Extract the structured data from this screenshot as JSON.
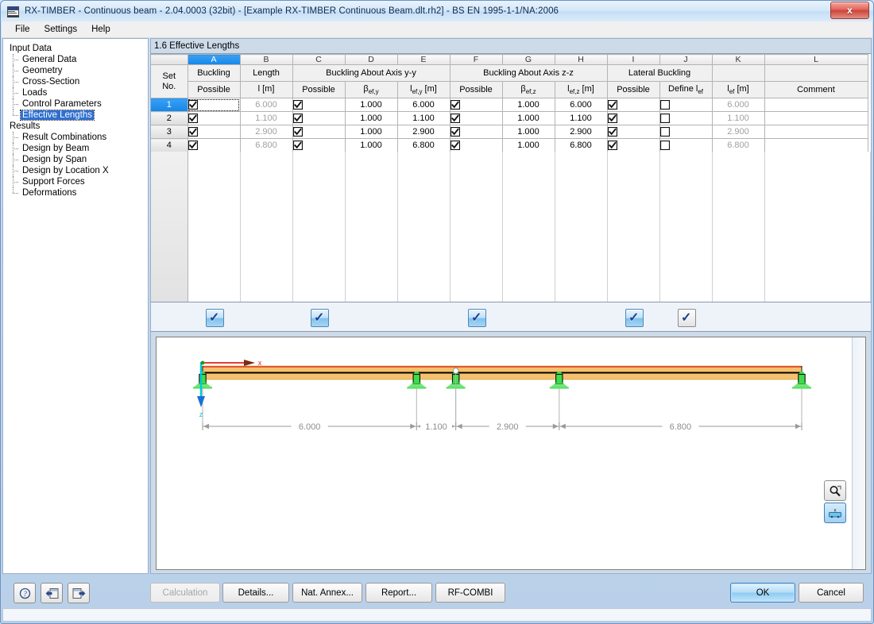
{
  "window": {
    "title": "RX-TIMBER - Continuous beam - 2.04.0003 (32bit) - [Example RX-TIMBER Continuous Beam.dlt.rh2] - BS EN 1995-1-1/NA:2006",
    "close_label": "x",
    "app_icon": "rx-timber-icon"
  },
  "menu": {
    "items": [
      {
        "label": "File"
      },
      {
        "label": "Settings"
      },
      {
        "label": "Help"
      }
    ]
  },
  "sidebar": {
    "groups": [
      {
        "label": "Input Data",
        "items": [
          {
            "label": "General Data",
            "selected": false
          },
          {
            "label": "Geometry",
            "selected": false
          },
          {
            "label": "Cross-Section",
            "selected": false
          },
          {
            "label": "Loads",
            "selected": false
          },
          {
            "label": "Control Parameters",
            "selected": false
          },
          {
            "label": "Effective Lengths",
            "selected": true
          }
        ]
      },
      {
        "label": "Results",
        "items": [
          {
            "label": "Result Combinations",
            "selected": false
          },
          {
            "label": "Design by Beam",
            "selected": false
          },
          {
            "label": "Design by Span",
            "selected": false
          },
          {
            "label": "Design by Location X",
            "selected": false
          },
          {
            "label": "Support Forces",
            "selected": false
          },
          {
            "label": "Deformations",
            "selected": false
          }
        ]
      }
    ]
  },
  "main": {
    "section_title": "1.6 Effective Lengths"
  },
  "table": {
    "column_letters": [
      "",
      "A",
      "B",
      "C",
      "D",
      "E",
      "F",
      "G",
      "H",
      "I",
      "J",
      "K",
      "L"
    ],
    "selected_column_letter": "A",
    "row_header": {
      "line1": "Set",
      "line2": "No."
    },
    "group_headers": [
      {
        "label": "Buckling",
        "span": 1
      },
      {
        "label": "Length",
        "span": 1
      },
      {
        "label": "Buckling About Axis y-y",
        "span": 3
      },
      {
        "label": "Buckling About Axis z-z",
        "span": 3
      },
      {
        "label": "Lateral Buckling",
        "span": 2
      },
      {
        "label": "",
        "span": 1
      },
      {
        "label": "",
        "span": 1
      }
    ],
    "sub_headers": [
      "Possible",
      "l [m]",
      "Possible",
      "βef,y",
      "lef,y [m]",
      "Possible",
      "βef,z",
      "lef,z [m]",
      "Possible",
      "Define lef",
      "lef [m]",
      "Comment"
    ],
    "sub_headers_rich": [
      {
        "text": "Possible"
      },
      {
        "base": "l",
        "sub": "",
        "unit": " [m]"
      },
      {
        "text": "Possible"
      },
      {
        "base": "β",
        "sub": "ef,y",
        "unit": ""
      },
      {
        "base": "l",
        "sub": "ef,y",
        "unit": " [m]"
      },
      {
        "text": "Possible"
      },
      {
        "base": "β",
        "sub": "ef,z",
        "unit": ""
      },
      {
        "base": "l",
        "sub": "ef,z",
        "unit": " [m]"
      },
      {
        "text": "Possible"
      },
      {
        "base": "Define l",
        "sub": "ef",
        "unit": ""
      },
      {
        "base": "l",
        "sub": "ef",
        "unit": " [m]"
      },
      {
        "text": "Comment"
      }
    ],
    "rows": [
      {
        "set_no": "1",
        "selected": true,
        "buckling_possible": true,
        "length": "6.000",
        "yy_possible": true,
        "beta_ef_y": "1.000",
        "l_ef_y": "6.000",
        "zz_possible": true,
        "beta_ef_z": "1.000",
        "l_ef_z": "6.000",
        "lat_possible": true,
        "define_lef": false,
        "l_ef": "6.000",
        "comment": ""
      },
      {
        "set_no": "2",
        "selected": false,
        "buckling_possible": true,
        "length": "1.100",
        "yy_possible": true,
        "beta_ef_y": "1.000",
        "l_ef_y": "1.100",
        "zz_possible": true,
        "beta_ef_z": "1.000",
        "l_ef_z": "1.100",
        "lat_possible": true,
        "define_lef": false,
        "l_ef": "1.100",
        "comment": ""
      },
      {
        "set_no": "3",
        "selected": false,
        "buckling_possible": true,
        "length": "2.900",
        "yy_possible": true,
        "beta_ef_y": "1.000",
        "l_ef_y": "2.900",
        "zz_possible": true,
        "beta_ef_z": "1.000",
        "l_ef_z": "2.900",
        "lat_possible": true,
        "define_lef": false,
        "l_ef": "2.900",
        "comment": ""
      },
      {
        "set_no": "4",
        "selected": false,
        "buckling_possible": true,
        "length": "6.800",
        "yy_possible": true,
        "beta_ef_y": "1.000",
        "l_ef_y": "6.800",
        "zz_possible": true,
        "beta_ef_z": "1.000",
        "l_ef_z": "6.800",
        "lat_possible": true,
        "define_lef": false,
        "l_ef": "6.800",
        "comment": ""
      }
    ]
  },
  "select_all_strip": {
    "checkboxes": [
      {
        "column": "A",
        "checked": true,
        "style": "blue"
      },
      {
        "column": "C",
        "checked": true,
        "style": "blue"
      },
      {
        "column": "F",
        "checked": true,
        "style": "blue"
      },
      {
        "column": "I",
        "checked": true,
        "style": "blue"
      },
      {
        "column": "J",
        "checked": true,
        "style": "plain"
      }
    ],
    "tick_glyph": "✓"
  },
  "graphics": {
    "spans": [
      {
        "label": "6.000",
        "value": 6.0
      },
      {
        "label": "1.100",
        "value": 1.1
      },
      {
        "label": "2.900",
        "value": 2.9
      },
      {
        "label": "6.800",
        "value": 6.8
      }
    ],
    "axis_x_label": "x",
    "axis_z_label": "z",
    "colors": {
      "beam_fill": "#f5c16c",
      "beam_top_line": "#e03c1e",
      "beam_centerline": "#000000",
      "support": "#3ddc4a",
      "dimension": "#9a9a9a",
      "axis_x": "#e02020",
      "axis_z": "#00c8e0"
    },
    "tools": [
      {
        "name": "zoom-reset-icon",
        "active": false
      },
      {
        "name": "view-axis-icon",
        "active": true
      }
    ]
  },
  "bottom": {
    "icon_buttons": [
      {
        "name": "help-button",
        "glyph": "?"
      },
      {
        "name": "previous-button",
        "glyph": "←"
      },
      {
        "name": "next-button",
        "glyph": "→"
      }
    ],
    "buttons": [
      {
        "label": "Calculation",
        "disabled": true,
        "primary": false
      },
      {
        "label": "Details...",
        "disabled": false,
        "primary": false
      },
      {
        "label": "Nat. Annex...",
        "disabled": false,
        "primary": false
      },
      {
        "label": "Report...",
        "disabled": false,
        "primary": false
      },
      {
        "label": "RF-COMBI",
        "disabled": false,
        "primary": false
      }
    ],
    "ok_label": "OK",
    "cancel_label": "Cancel"
  }
}
